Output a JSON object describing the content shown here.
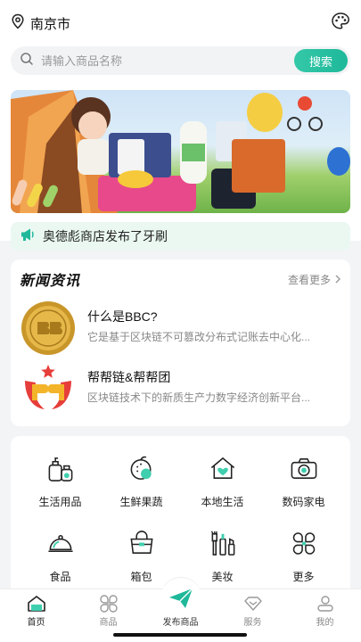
{
  "header": {
    "location": "南京市",
    "location_icon": "map-pin-icon",
    "theme_icon": "palette-icon"
  },
  "search": {
    "placeholder": "请输入商品名称",
    "button_label": "搜索"
  },
  "banner": {
    "description_icon": "camping-banner-image"
  },
  "notice": {
    "icon": "megaphone-icon",
    "text": "奥德彪商店发布了牙刷"
  },
  "news": {
    "title": "新闻资讯",
    "more_label": "查看更多",
    "items": [
      {
        "title": "什么是BBC?",
        "desc": "它是基于区块链不可篡改分布式记账去中心化..."
      },
      {
        "title": "帮帮链&帮帮团",
        "desc": "区块链技术下的新质生产力数字经济创新平台..."
      }
    ]
  },
  "categories": [
    {
      "label": "生活用品",
      "icon": "toiletries-icon"
    },
    {
      "label": "生鲜果蔬",
      "icon": "fruit-icon"
    },
    {
      "label": "本地生活",
      "icon": "house-heart-icon"
    },
    {
      "label": "数码家电",
      "icon": "camera-icon"
    },
    {
      "label": "食品",
      "icon": "food-cloche-icon"
    },
    {
      "label": "箱包",
      "icon": "handbag-icon"
    },
    {
      "label": "美妆",
      "icon": "makeup-brush-icon"
    },
    {
      "label": "更多",
      "icon": "more-grid-icon"
    }
  ],
  "tabbar": {
    "items": [
      {
        "label": "首页",
        "icon": "home-icon"
      },
      {
        "label": "商品",
        "icon": "grid-icon"
      },
      {
        "label": "发布商品",
        "icon": "paper-plane-icon"
      },
      {
        "label": "服务",
        "icon": "service-diamond-icon"
      },
      {
        "label": "我的",
        "icon": "user-icon"
      }
    ]
  },
  "colors": {
    "accent": "#1eb89a",
    "notice_bg": "#eaf8f1",
    "page_bg": "#f3f4f6"
  }
}
